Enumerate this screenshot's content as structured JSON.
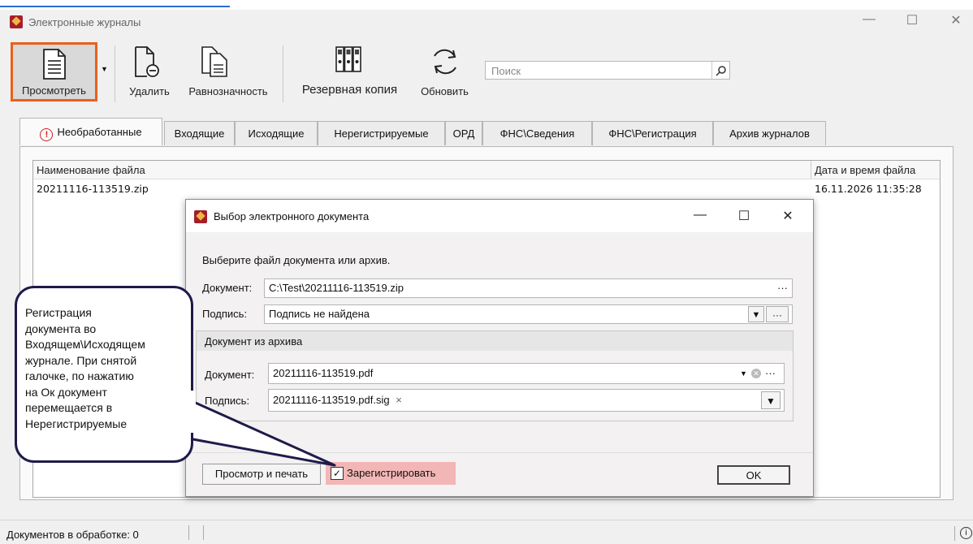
{
  "app": {
    "title": "Электронные журналы"
  },
  "toolbar": {
    "view_label": "Просмотреть",
    "delete_label": "Удалить",
    "equivalence_label": "Равнозначность",
    "backup_label": "Резервная копия",
    "refresh_label": "Обновить",
    "search_placeholder": "Поиск"
  },
  "tabs": [
    {
      "label": "Необработанные",
      "active": true
    },
    {
      "label": "Входящие"
    },
    {
      "label": "Исходящие"
    },
    {
      "label": "Нерегистрируемые"
    },
    {
      "label": "ОРД"
    },
    {
      "label": "ФНС\\Сведения"
    },
    {
      "label": "ФНС\\Регистрация"
    },
    {
      "label": "Архив журналов"
    }
  ],
  "table": {
    "columns": [
      "Наименование файла",
      "Дата и время файла"
    ],
    "rows": [
      [
        "20211116-113519.zip",
        "16.11.2026 11:35:28"
      ]
    ]
  },
  "dialog": {
    "title": "Выбор электронного документа",
    "prompt": "Выберите файл документа или архив.",
    "document_label": "Документ:",
    "document_value": "C:\\Test\\20211116-113519.zip",
    "signature_label": "Подпись:",
    "signature_value": "Подпись не найдена",
    "archive_group_title": "Документ из архива",
    "archive_document_label": "Документ:",
    "archive_document_value": "20211116-113519.pdf",
    "archive_signature_label": "Подпись:",
    "archive_signature_value": "20211116-113519.pdf.sig",
    "print_button": "Просмотр и печать",
    "register_label": "Зарегистрировать",
    "register_checked": true,
    "ok_button": "OK"
  },
  "callout": {
    "text_lines": [
      "Регистрация",
      "документа во",
      "Входящем\\Исходящем",
      "журнале. При снятой",
      "галочке, по нажатию",
      "на Ок документ",
      "перемещается в",
      "Нерегистрируемые"
    ]
  },
  "status": {
    "in_progress_label": "Документов в обработке: 0"
  },
  "colors": {
    "highlight": "#e8601a",
    "callout_border": "#1e1b4a",
    "register_bg": "#f3b6b6"
  }
}
